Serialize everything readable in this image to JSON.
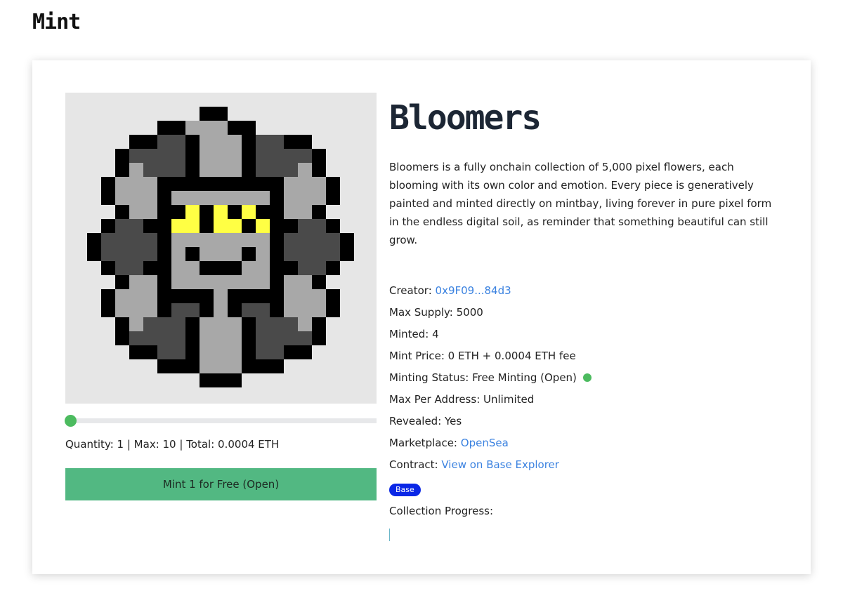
{
  "page": {
    "title": "Mint"
  },
  "artwork": {
    "icon": "pixel-flower-artwork",
    "colors": {
      "background": "#e6e6e6",
      "outline": "#000000",
      "light_petal": "#a8a8a8",
      "dark_petal": "#4a4a4a",
      "highlight": "#ffff44"
    }
  },
  "mint_panel": {
    "quantity_value": 1,
    "quantity_max": 10,
    "quantity_text": "Quantity: 1 | Max: 10 | Total: 0.0004 ETH",
    "button_label": "Mint 1 for Free (Open)"
  },
  "collection": {
    "name": "Bloomers",
    "description": "Bloomers is a fully onchain collection of 5,000 pixel flowers, each blooming with its own color and emotion. Every piece is generatively painted and minted directly on mintbay, living forever in pure pixel form in the endless digital soil, as reminder that something beautiful can still grow.",
    "details": {
      "creator_label": "Creator:",
      "creator_value": "0x9F09...84d3",
      "max_supply": "Max Supply: 5000",
      "minted": "Minted: 4",
      "mint_price": "Mint Price: 0 ETH + 0.0004 ETH fee",
      "status": "Minting Status: Free Minting (Open)",
      "max_per_address": "Max Per Address: Unlimited",
      "revealed": "Revealed: Yes",
      "marketplace_label": "Marketplace:",
      "marketplace_value": "OpenSea",
      "contract_label": "Contract:",
      "contract_value": "View on Base Explorer"
    },
    "chain_badge": "Base",
    "progress_label": "Collection Progress:",
    "progress_fraction": 0.0008
  },
  "colors": {
    "accent_green": "#52b882",
    "status_dot": "#4cbb5f",
    "link_blue": "#3b82e0",
    "badge_blue": "#0a27e6"
  }
}
